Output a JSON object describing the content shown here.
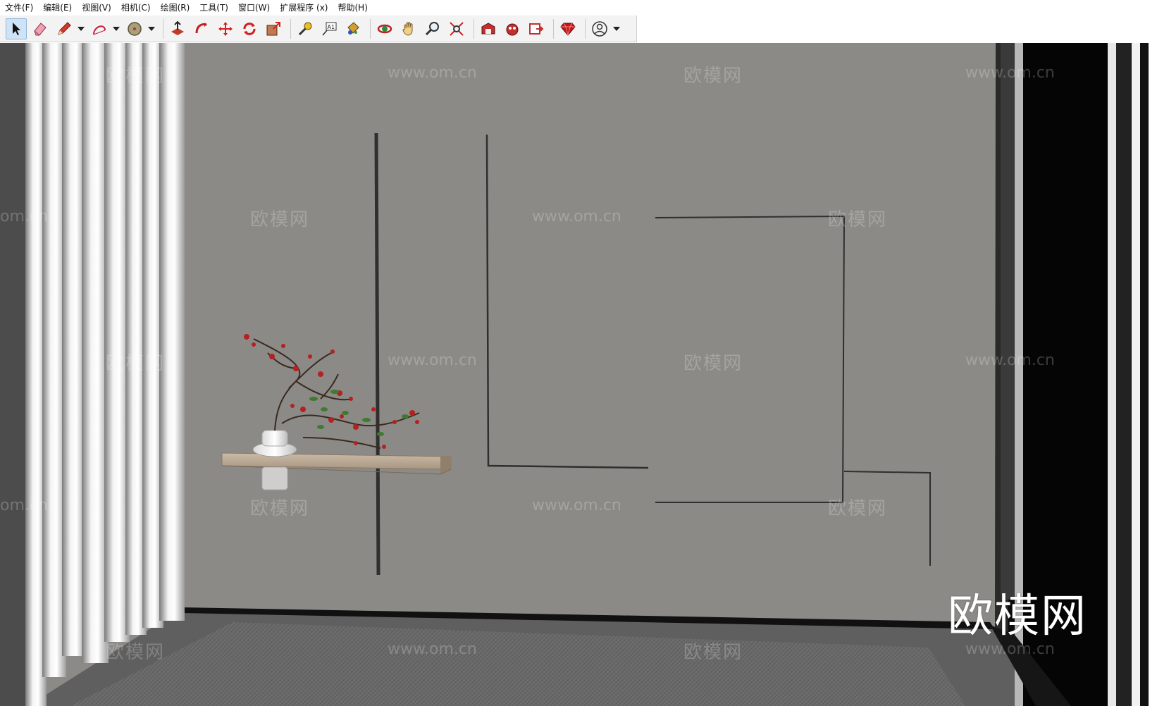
{
  "menu": {
    "items": [
      "文件(F)",
      "编辑(E)",
      "视图(V)",
      "相机(C)",
      "绘图(R)",
      "工具(T)",
      "窗口(W)",
      "扩展程序 (x)",
      "帮助(H)"
    ]
  },
  "toolbar": {
    "tools": [
      "select-tool",
      "eraser-tool",
      "pencil-tool",
      "arc-tool",
      "shape-tool",
      "push-pull-tool",
      "follow-me-tool",
      "move-tool",
      "rotate-tool",
      "scale-tool",
      "tape-measure-tool",
      "text-tool",
      "paint-bucket-tool",
      "orbit-tool",
      "pan-tool",
      "zoom-tool",
      "zoom-extents-tool",
      "warehouse-tool",
      "extension-warehouse-tool",
      "send-to-layout-tool",
      "ruby-console-tool",
      "account-tool"
    ],
    "text_tool_glyph": "A1"
  },
  "watermarks": {
    "cn": "欧模网",
    "url": "www.om.cn",
    "url_partial": "om.cn",
    "big": "欧模网"
  },
  "colors": {
    "wall": "#8c8a86",
    "floor": "#5f5f5f",
    "curtain_light": "#e9e9e9",
    "shelf": "#b7a795",
    "berry": "#b52020",
    "leaf": "#3f7a2e"
  }
}
